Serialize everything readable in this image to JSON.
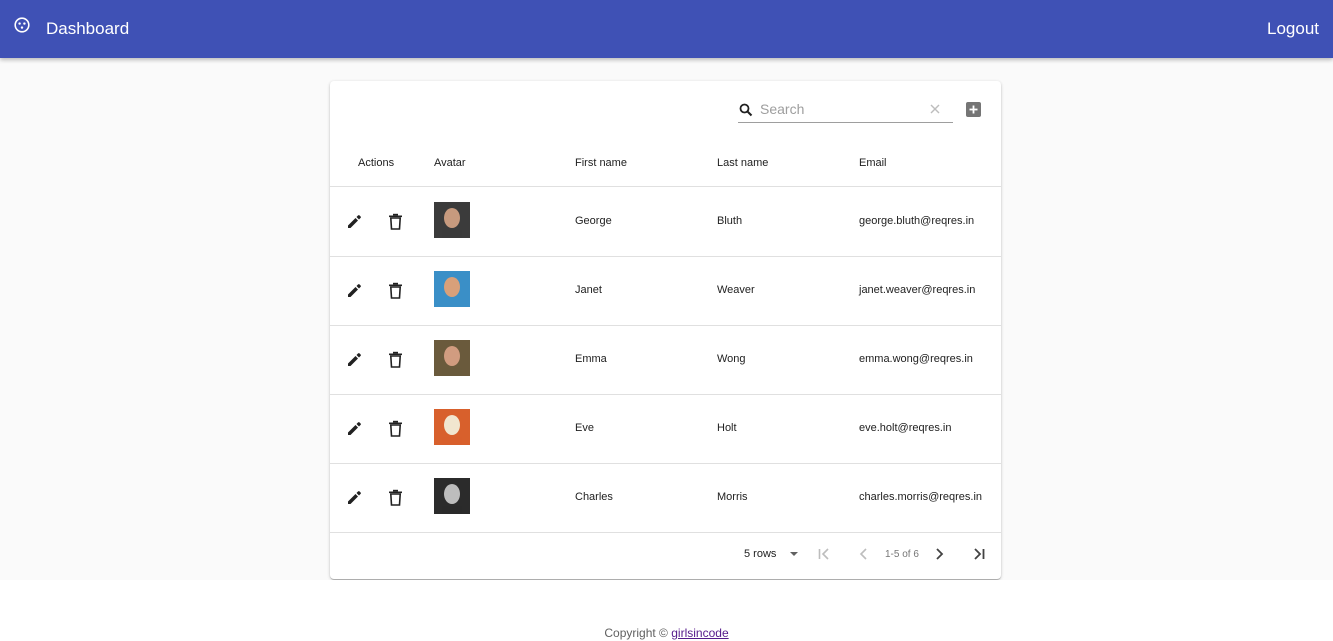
{
  "appbar": {
    "title": "Dashboard",
    "logout_label": "Logout",
    "logo_icon": "face-icon",
    "color": "#3f51b5"
  },
  "toolbar": {
    "search_placeholder": "Search",
    "search_value": "",
    "search_icon": "search-icon",
    "clear_icon": "close-icon",
    "add_icon": "add-box-icon"
  },
  "table": {
    "headers": {
      "actions": "Actions",
      "avatar": "Avatar",
      "first_name": "First name",
      "last_name": "Last name",
      "email": "Email"
    },
    "rows": [
      {
        "first_name": "George",
        "last_name": "Bluth",
        "email": "george.bluth@reqres.in",
        "avatar_colors": [
          "#3b3b3b",
          "#c79a7e"
        ]
      },
      {
        "first_name": "Janet",
        "last_name": "Weaver",
        "email": "janet.weaver@reqres.in",
        "avatar_colors": [
          "#3a8fc7",
          "#d8a07a"
        ]
      },
      {
        "first_name": "Emma",
        "last_name": "Wong",
        "email": "emma.wong@reqres.in",
        "avatar_colors": [
          "#6a5a3c",
          "#d19c80"
        ]
      },
      {
        "first_name": "Eve",
        "last_name": "Holt",
        "email": "eve.holt@reqres.in",
        "avatar_colors": [
          "#d8602c",
          "#f1e6cf"
        ]
      },
      {
        "first_name": "Charles",
        "last_name": "Morris",
        "email": "charles.morris@reqres.in",
        "avatar_colors": [
          "#2b2b2b",
          "#bdbdbd"
        ]
      }
    ]
  },
  "pagination": {
    "rows_label": "5 rows",
    "range": "1-5 of 6"
  },
  "footer": {
    "copyright": "Copyright ©",
    "link": "girlsincode"
  }
}
